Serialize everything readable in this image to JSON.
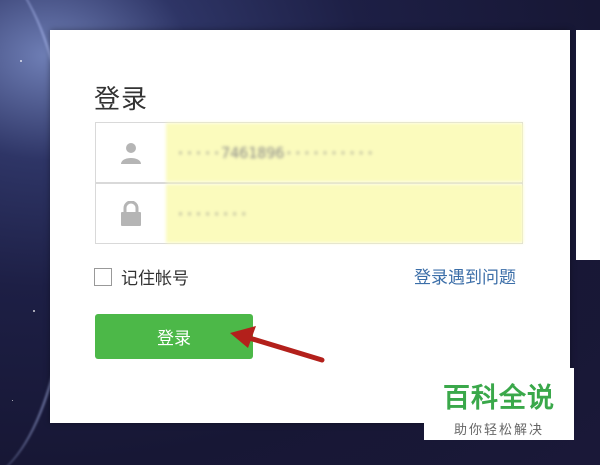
{
  "login": {
    "title": "登录",
    "username_value": "·····7461896··········",
    "password_value": "········",
    "remember_label": "记住帐号",
    "help_link": "登录遇到问题",
    "submit_label": "登录"
  },
  "icons": {
    "username": "user-icon",
    "password": "lock-icon"
  },
  "colors": {
    "primary_button": "#4cb848",
    "link": "#3b6ea8",
    "autofill_background": "#fbfbbd",
    "annotation_arrow": "#b3201b"
  },
  "watermark": {
    "title": "百科全说",
    "subtitle": "助你轻松解决"
  }
}
